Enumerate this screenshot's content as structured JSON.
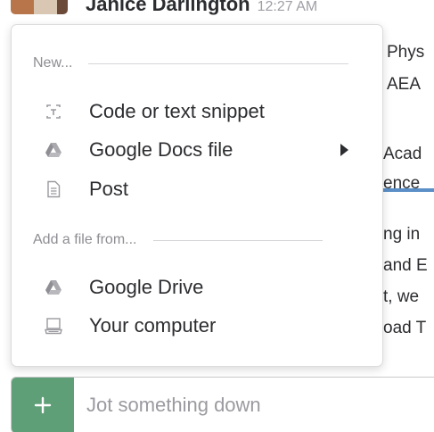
{
  "message": {
    "sender": "Janice Darlington",
    "timestamp": "12:27 AM",
    "lines": [
      "Phys",
      "AEA",
      "Acad",
      "ence",
      "ng in",
      "and E",
      "t, we",
      "oad T"
    ]
  },
  "menu": {
    "new_heading": "New...",
    "new_items": [
      {
        "label": "Code or text snippet",
        "icon": "snippet-icon"
      },
      {
        "label": "Google Docs file",
        "icon": "google-drive-icon"
      },
      {
        "label": "Post",
        "icon": "document-icon"
      }
    ],
    "add_heading": "Add a file from...",
    "add_items": [
      {
        "label": "Google Drive",
        "icon": "google-drive-icon"
      },
      {
        "label": "Your computer",
        "icon": "computer-icon"
      }
    ]
  },
  "composer": {
    "placeholder": "Jot something down",
    "add_button_icon": "plus-icon"
  },
  "colors": {
    "accent_green": "#5e9f77",
    "connector_blue": "#5b8fc7"
  }
}
